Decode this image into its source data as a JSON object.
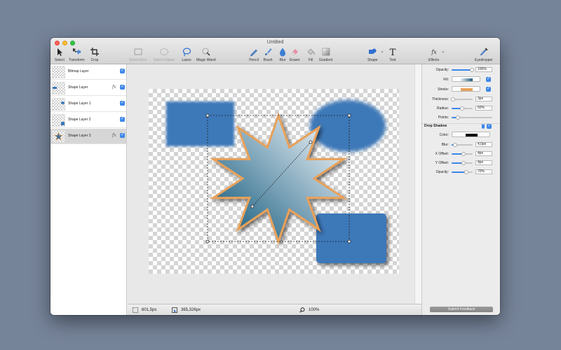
{
  "window": {
    "title": "Untitled"
  },
  "toolbar": {
    "select": "Select",
    "transform": "Transform",
    "crop": "Crop",
    "select_rect": "Select Rect",
    "select_ellipse": "Select Ellipse",
    "lasso": "Lasso",
    "magic_wand": "Magic Wand",
    "pencil": "Pencil",
    "brush": "Brush",
    "blur": "Blur",
    "eraser": "Eraser",
    "fill": "Fill",
    "gradient": "Gradient",
    "shape": "Shape",
    "text": "Text",
    "effects": "Effects",
    "eyedropper": "Eyedropper"
  },
  "layers": [
    {
      "name": "Bitmap Layer",
      "fx": "",
      "visible": true
    },
    {
      "name": "Shape Layer",
      "fx": "fx",
      "visible": true
    },
    {
      "name": "Shape Layer 1",
      "fx": "",
      "visible": true
    },
    {
      "name": "Shape Layer 2",
      "fx": "",
      "visible": true
    },
    {
      "name": "Shape Layer 3",
      "fx": "fx",
      "visible": true,
      "selected": true
    }
  ],
  "status": {
    "size": "601,5px",
    "position": "365,326px",
    "zoom": "100%"
  },
  "inspector": {
    "opacity_label": "Opacity:",
    "opacity_value": "100%",
    "opacity_level": 1.0,
    "fill_label": "Fill:",
    "stroke_label": "Stroke:",
    "thickness_label": "Thickness:",
    "thickness_value": "3px",
    "thickness_level": 0.05,
    "radius_label": "Radius:",
    "radius_value": "50%",
    "radius_level": 0.5,
    "points_label": "Points:",
    "points_level": 0.15,
    "drop_shadow_label": "Drop Shadow",
    "color_label": "Color:",
    "blur_label": "Blur:",
    "blur_value": "4,0px",
    "blur_level": 0.15,
    "xoffset_label": "X Offset:",
    "xoffset_value": "4px",
    "xoffset_level": 0.55,
    "yoffset_label": "Y Offset:",
    "yoffset_value": "4px",
    "yoffset_level": 0.55,
    "shadow_opacity_label": "Opacity:",
    "shadow_opacity_value": "70%",
    "shadow_opacity_level": 0.7,
    "submit_feedback": "Submit Feedback"
  },
  "colors": {
    "accent": "#3d86e8",
    "shape_blue": "#3d78b8",
    "stroke": "#e8a15a",
    "shadow": "#000000"
  }
}
